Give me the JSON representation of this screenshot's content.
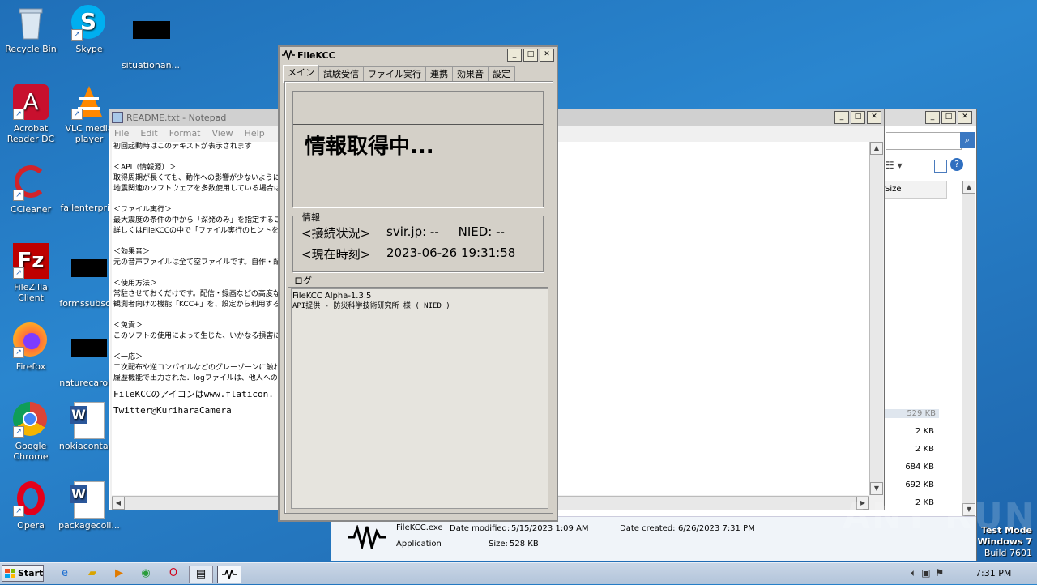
{
  "desktop": {
    "icons": [
      {
        "label": "Recycle Bin",
        "icon": "recycle-bin-icon"
      },
      {
        "label": "Skype",
        "icon": "skype-icon"
      },
      {
        "label": "situationan...",
        "icon": "redacted-file-icon"
      },
      {
        "label": "Acrobat Reader DC",
        "icon": "acrobat-icon"
      },
      {
        "label": "VLC media player",
        "icon": "vlc-icon"
      },
      {
        "label": "CCleaner",
        "icon": "ccleaner-icon"
      },
      {
        "label": "fallenterpri...",
        "icon": "file-icon"
      },
      {
        "label": "FileZilla Client",
        "icon": "filezilla-icon"
      },
      {
        "label": "formssubsc...",
        "icon": "redacted-file-icon"
      },
      {
        "label": "Firefox",
        "icon": "firefox-icon"
      },
      {
        "label": "naturecarol...",
        "icon": "redacted-file-icon"
      },
      {
        "label": "Google Chrome",
        "icon": "chrome-icon"
      },
      {
        "label": "nokiacontai...",
        "icon": "word-doc-icon"
      },
      {
        "label": "Opera",
        "icon": "opera-icon"
      },
      {
        "label": "packagecoll...",
        "icon": "word-doc-icon"
      }
    ]
  },
  "notepad": {
    "title": "README.txt - Notepad",
    "menu": [
      "File",
      "Edit",
      "Format",
      "View",
      "Help"
    ],
    "lines": [
      "初回起動時はこのテキストが表示されます",
      "",
      "＜API（情報源）＞",
      "取得周期が長くても、動作への影響が少ないように設",
      "地震関連のソフトウェアを多数使用している場合は、",
      "",
      "＜ファイル実行＞",
      "最大震度の条件の中から「深発のみ」を指定すること",
      "詳しくはFileKCCの中で「ファイル実行のヒントを、",
      "",
      "＜効果音＞",
      "元の音声ファイルは全て空ファイルです。自作・配布を",
      "",
      "＜使用方法＞",
      "常駐させておくだけです。配信・録画などの高度な使い",
      "観測者向けの機能「KCC+」を、設定から利用する",
      "",
      "＜免責＞",
      "このソフトの使用によって生じた、いかなる損害にも作",
      "",
      "＜一応＞",
      "二次配布や逆コンパイルなどのグレーゾーンに触れる事",
      "履歴機能で出力された．logファイルは、他人への"
    ],
    "line_big1": "FileKCCのアイコンはwww.flaticon.",
    "line_big2": "Twitter@KuriharaCamera"
  },
  "filekcc": {
    "title": "FileKCC",
    "tabs": [
      "メイン",
      "試験受信",
      "ファイル実行",
      "連携",
      "効果音",
      "設定"
    ],
    "status_text": "情報取得中...",
    "info_group": "情報",
    "connection_label": "<接続状況>",
    "connection_value": "svir.jp: --     NIED: --",
    "time_label": "<現在時刻>",
    "time_value": "2023-06-26 19:31:58",
    "log_group": "ログ",
    "log_lines": [
      "FileKCC Alpha-1.3.5",
      "API提供 - 防災科学技術研究所 様 ( NIED )"
    ]
  },
  "explorer": {
    "column_header": "Size",
    "sizes": [
      "529 KB",
      "2 KB",
      "2 KB",
      "684 KB",
      "692 KB",
      "2 KB"
    ],
    "details": {
      "file_name": "FileKCC.exe",
      "date_modified_label": "Date modified:",
      "date_modified": "5/15/2023 1:09 AM",
      "date_created_label": "Date created:",
      "date_created": "6/26/2023 7:31 PM",
      "type": "Application",
      "size_label": "Size:",
      "size": "528 KB"
    }
  },
  "watermark": {
    "line1": "Test Mode",
    "line2": "Windows 7",
    "line3": "Build 7601",
    "anyrun": "ANY RUN"
  },
  "taskbar": {
    "start_label": "Start",
    "clock": "7:31 PM"
  }
}
